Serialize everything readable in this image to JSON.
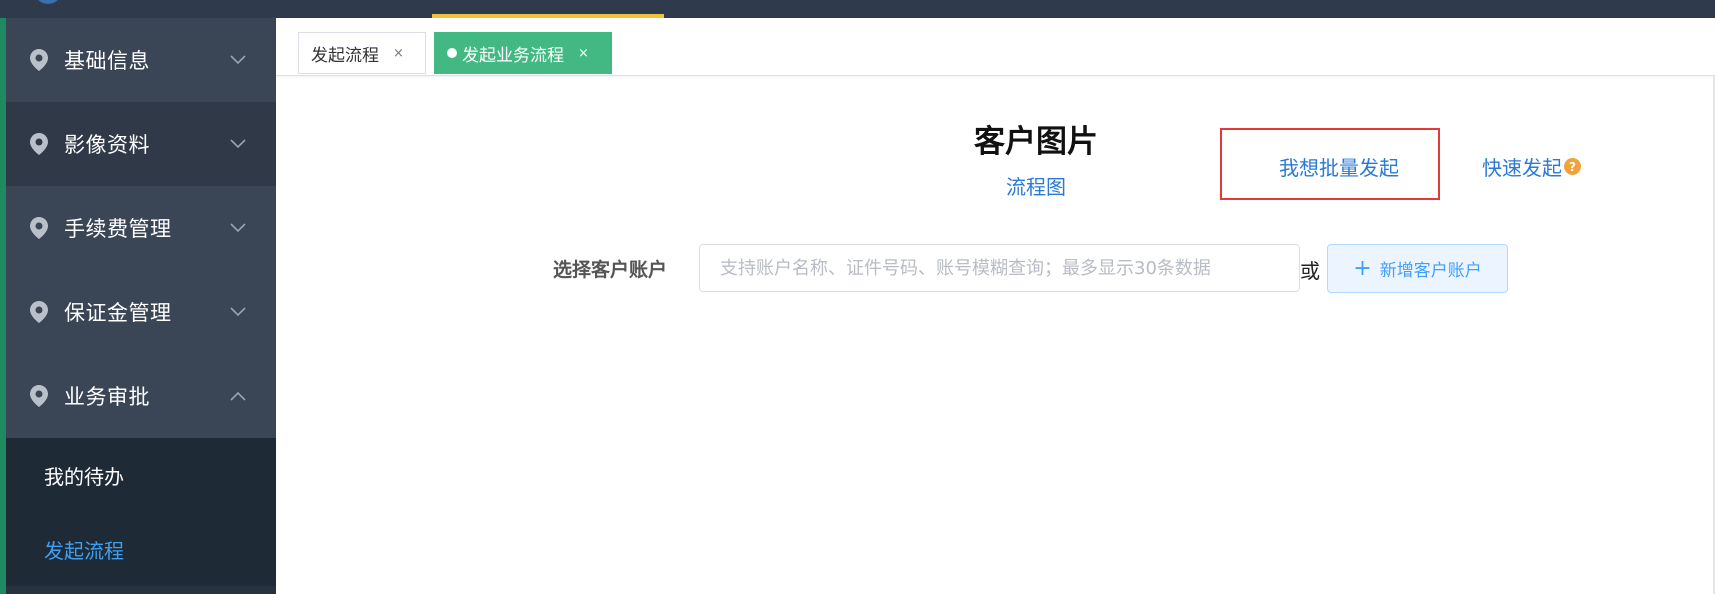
{
  "sidebar": {
    "items": [
      {
        "label": "基础信息",
        "expanded": false
      },
      {
        "label": "影像资料",
        "expanded": false
      },
      {
        "label": "手续费管理",
        "expanded": false
      },
      {
        "label": "保证金管理",
        "expanded": false
      },
      {
        "label": "业务审批",
        "expanded": true
      }
    ],
    "submenu": [
      {
        "label": "我的待办",
        "active": false
      },
      {
        "label": "发起流程",
        "active": true
      }
    ]
  },
  "tabs": [
    {
      "label": "发起流程",
      "close": "×",
      "active": false
    },
    {
      "label": "发起业务流程",
      "close": "×",
      "active": true
    }
  ],
  "main": {
    "title": "客户图片",
    "flowchart_link": "流程图",
    "batch_link": "我想批量发起",
    "quick_link": "快速发起",
    "help_glyph": "?",
    "select_label": "选择客户账户",
    "search_placeholder": "支持账户名称、证件号码、账号模糊查询；最多显示30条数据",
    "search_value": "",
    "or_text": "或",
    "add_button_plus": "+",
    "add_button_label": "新增客户账户"
  },
  "colors": {
    "sidebar_bg": "#27313f",
    "active_tab": "#42b983",
    "link": "#2b79d6",
    "submenu_active": "#3fa0f2",
    "highlight_box": "#e23a3a",
    "help_icon": "#f0a33a"
  },
  "icons": {
    "menu_item": "map-pin-icon",
    "collapsed": "chevron-down-icon",
    "expanded": "chevron-up-icon",
    "help": "question-circle-icon",
    "add": "plus-icon"
  }
}
